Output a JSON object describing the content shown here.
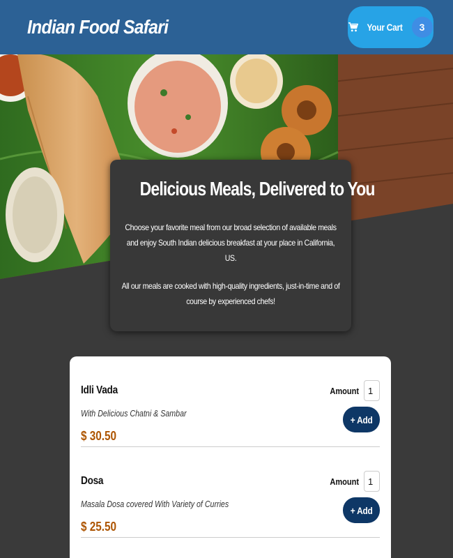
{
  "header": {
    "title": "Indian Food Safari",
    "cart": {
      "label": "Your Cart",
      "count": "3",
      "icon": "cart-icon"
    }
  },
  "summary": {
    "heading": "Delicious Meals, Delivered to You",
    "paragraph1": "Choose your favorite meal from our broad selection of available meals and enjoy South Indian delicious breakfast at your place in California, US.",
    "paragraph2": "All our meals are cooked with high-quality ingredients, just-in-time and of course by experienced chefs!"
  },
  "meals": [
    {
      "name": "Idli Vada",
      "description": "With Delicious Chatni & Sambar",
      "price": "$ 30.50",
      "amount_label": "Amount",
      "amount_value": "1",
      "add_label": "+ Add"
    },
    {
      "name": "Dosa",
      "description": "Masala Dosa covered With Variety of Curries",
      "price": "$ 25.50",
      "amount_label": "Amount",
      "amount_value": "1",
      "add_label": "+ Add"
    }
  ],
  "colors": {
    "header_bg": "#2c6195",
    "cart_button": "#27a3e6",
    "cart_badge": "#3f8de4",
    "page_bg": "#3a3a3a",
    "add_button": "#0e3766",
    "price": "#ad5502"
  }
}
